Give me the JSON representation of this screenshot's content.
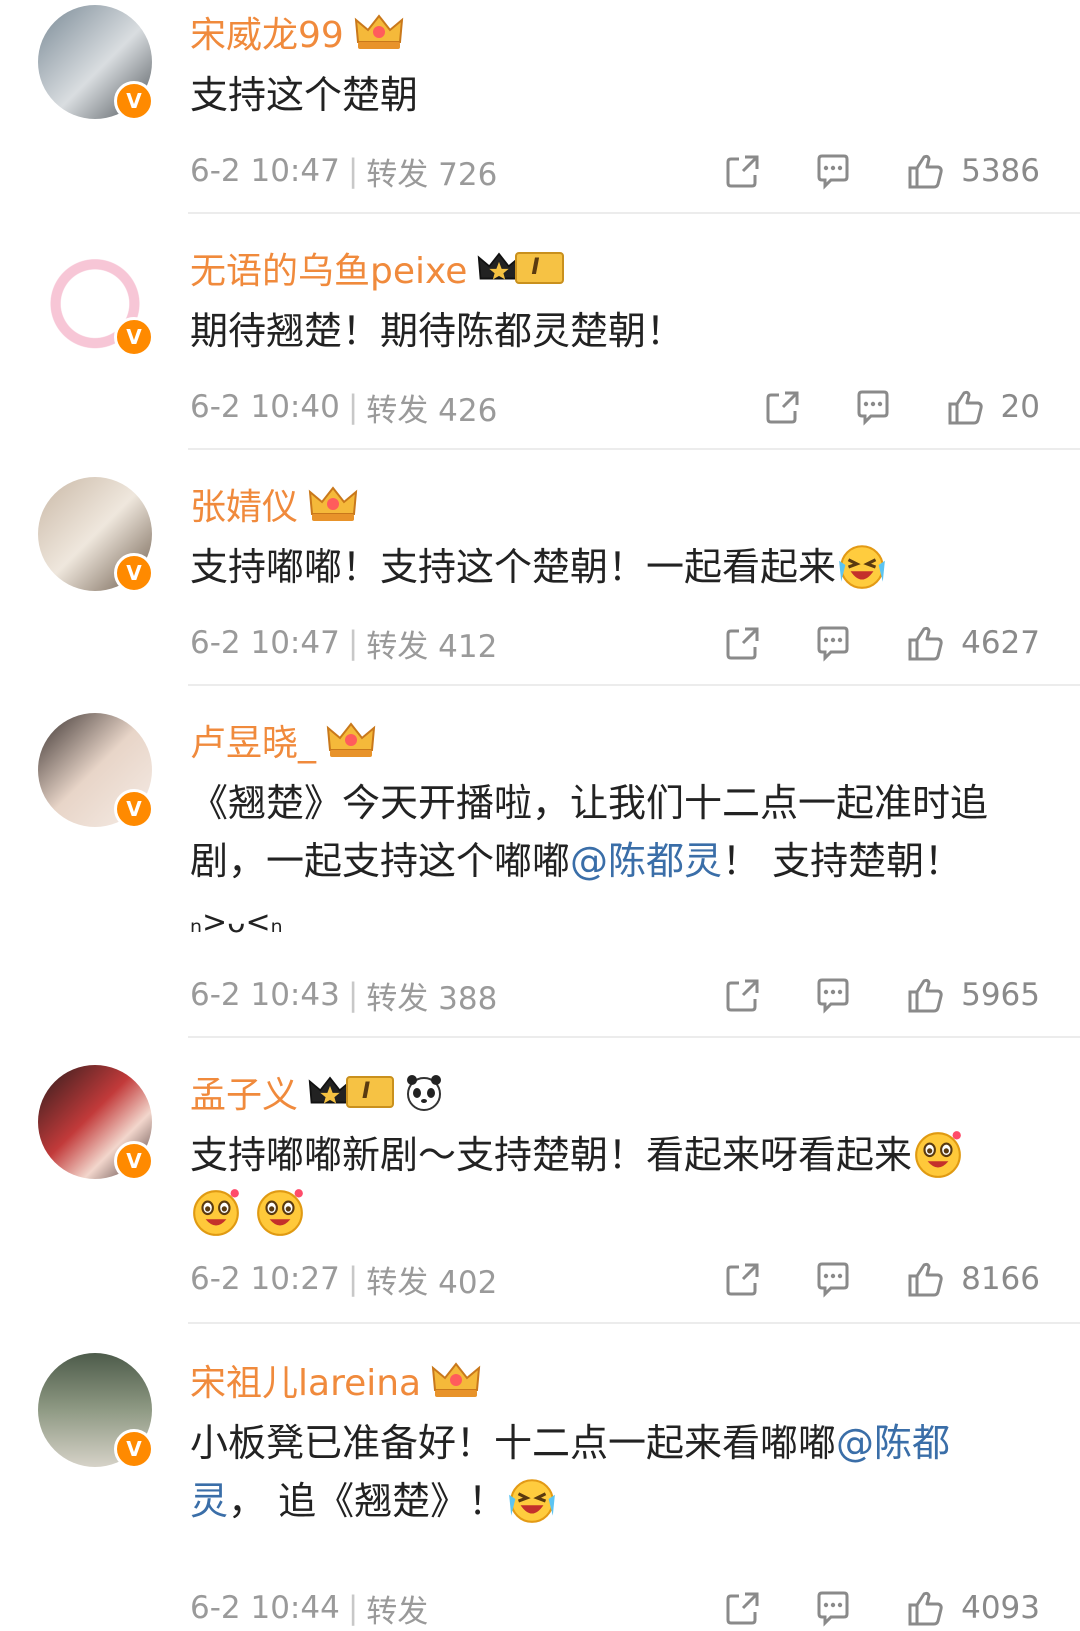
{
  "comments": [
    {
      "name": "宋威龙99",
      "text": "支持这个楚朝",
      "time": "6-2 10:47",
      "repost": "转发 726",
      "likes": "5386"
    },
    {
      "name": "无语的乌鱼peixe",
      "text": "期待翘楚！期待陈都灵楚朝！",
      "time": "6-2 10:40",
      "repost": "转发 426",
      "likes": "20"
    },
    {
      "name": "张婧仪",
      "text": "支持嘟嘟！支持这个楚朝！一起看起来",
      "time": "6-2 10:47",
      "repost": "转发 412",
      "likes": "4627"
    },
    {
      "name": "卢昱晓_",
      "text_a": "《翘楚》今天开播啦，让我们十二点一起准时追剧，一起支持这个嘟嘟",
      "mention": "@陈都灵",
      "text_b": "！ 支持楚朝！",
      "kaomoji": "ₙ>ᴗ<ₙ",
      "time": "6-2 10:43",
      "repost": "转发 388",
      "likes": "5965"
    },
    {
      "name": "孟子义",
      "text": "支持嘟嘟新剧～支持楚朝！看起来呀看起来",
      "time": "6-2 10:27",
      "repost": "转发 402",
      "likes": "8166"
    },
    {
      "name": "宋祖儿lareina",
      "text_a": "小板凳已准备好！十二点一起来看嘟嘟",
      "mention_a": "@陈都",
      "mention_b": "灵",
      "text_b": "， 追《翘楚》！",
      "time": "6-2 10:44",
      "repost": "转发",
      "likes": "4093"
    }
  ],
  "level_badge": "I",
  "verified_badge": "V",
  "colors": {
    "name": "#f08a3c",
    "mention": "#3a6ea8",
    "meta": "#9a9a9a",
    "badge": "#ff8a00"
  }
}
